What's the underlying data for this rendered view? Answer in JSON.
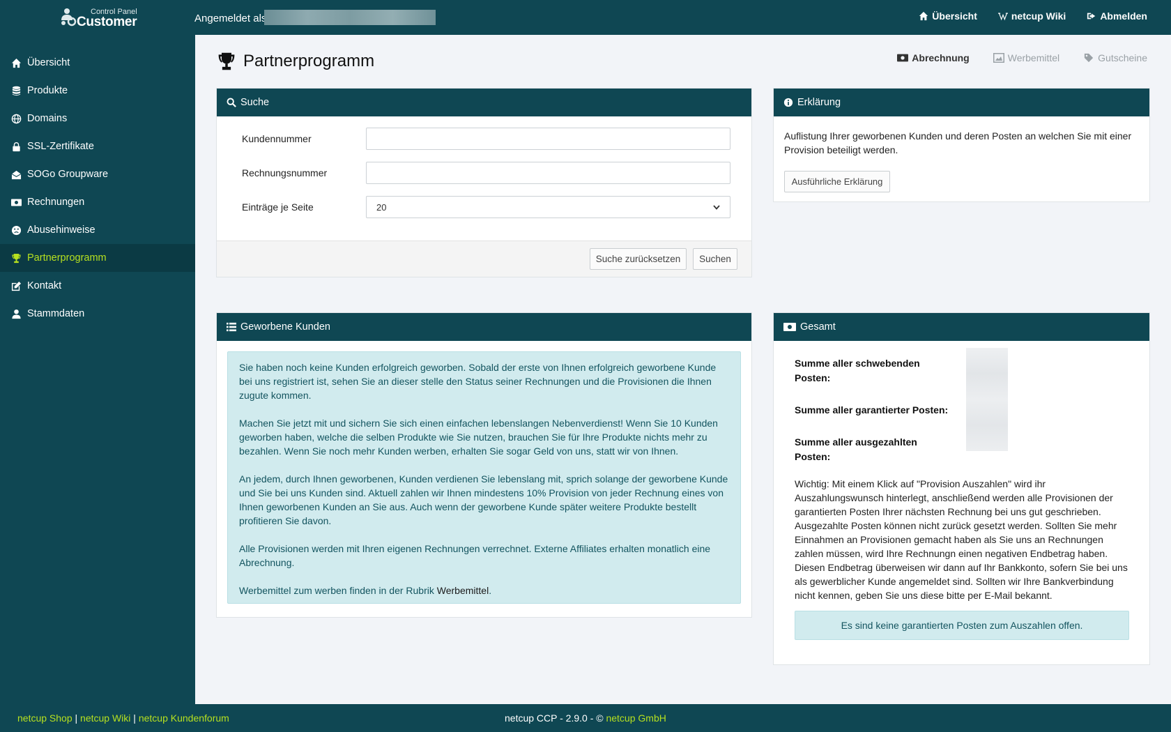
{
  "header": {
    "logo_small": "Control Panel",
    "logo_big": "Customer",
    "logged_in_label": "Angemeldet als",
    "nav": [
      {
        "label": "Übersicht",
        "icon": "home-icon"
      },
      {
        "label": "netcup Wiki",
        "icon": "wikipedia-icon"
      },
      {
        "label": "Abmelden",
        "icon": "sign-out-icon"
      }
    ]
  },
  "sidebar": {
    "items": [
      {
        "label": "Übersicht",
        "icon": "home-icon",
        "active": false
      },
      {
        "label": "Produkte",
        "icon": "database-icon",
        "active": false
      },
      {
        "label": "Domains",
        "icon": "globe-icon",
        "active": false
      },
      {
        "label": "SSL-Zertifikate",
        "icon": "lock-icon",
        "active": false
      },
      {
        "label": "SOGo Groupware",
        "icon": "envelope-open-icon",
        "active": false
      },
      {
        "label": "Rechnungen",
        "icon": "money-icon",
        "active": false
      },
      {
        "label": "Abusehinweise",
        "icon": "frown-icon",
        "active": false
      },
      {
        "label": "Partnerprogramm",
        "icon": "trophy-icon",
        "active": true
      },
      {
        "label": "Kontakt",
        "icon": "edit-icon",
        "active": false
      },
      {
        "label": "Stammdaten",
        "icon": "user-icon",
        "active": false
      }
    ]
  },
  "page": {
    "title": "Partnerprogramm",
    "tabs": [
      {
        "label": "Abrechnung",
        "icon": "money-icon",
        "active": true
      },
      {
        "label": "Werbemittel",
        "icon": "image-icon",
        "active": false
      },
      {
        "label": "Gutscheine",
        "icon": "tag-icon",
        "active": false
      }
    ]
  },
  "search": {
    "title": "Suche",
    "customer_number_label": "Kundennummer",
    "customer_number_value": "",
    "invoice_number_label": "Rechnungsnummer",
    "invoice_number_value": "",
    "per_page_label": "Einträge je Seite",
    "per_page_value": "20",
    "reset_button": "Suche zurücksetzen",
    "search_button": "Suchen"
  },
  "explanation": {
    "title": "Erklärung",
    "text": "Auflistung Ihrer geworbenen Kunden und deren Posten an welchen Sie mit einer Provision beteiligt werden.",
    "button": "Ausführliche Erklärung"
  },
  "customers": {
    "title": "Geworbene Kunden",
    "paragraphs": [
      "Sie haben noch keine Kunden erfolgreich geworben. Sobald der erste von Ihnen erfolgreich geworbene Kunde bei uns registriert ist, sehen Sie an dieser stelle den Status seiner Rechnungen und die Provisionen die Ihnen zugute kommen.",
      "Machen Sie jetzt mit und sichern Sie sich einen einfachen lebenslangen Nebenverdienst! Wenn Sie 10 Kunden geworben haben, welche die selben Produkte wie Sie nutzen, brauchen Sie für Ihre Produkte nichts mehr zu bezahlen. Wenn Sie noch mehr Kunden werben, erhalten Sie sogar Geld von uns, statt wir von Ihnen.",
      "An jedem, durch Ihnen geworbenen, Kunden verdienen Sie lebenslang mit, sprich solange der geworbene Kunde und Sie bei uns Kunden sind. Aktuell zahlen wir Ihnen mindestens 10% Provision von jeder Rechnung eines von Ihnen geworbenen Kunden an Sie aus. Auch wenn der geworbene Kunde später weitere Produkte bestellt profitieren Sie davon.",
      "Alle Provisionen werden mit Ihren eigenen Rechnungen verrechnet. Externe Affiliates erhalten monatlich eine Abrechnung."
    ],
    "last_prefix": "Werbemittel zum werben finden in der Rubrik",
    "last_link": "Werbemittel",
    "last_suffix": "."
  },
  "total": {
    "title": "Gesamt",
    "pending_label": "Summe aller schwebenden Posten:",
    "guaranteed_label": "Summe aller garantierter Posten:",
    "paid_label": "Summe aller ausgezahlten Posten:",
    "notice": "Wichtig: Mit einem Klick auf \"Provision Auszahlen\" wird ihr Auszahlungswunsch hinterlegt, anschließend werden alle Provisionen der garantierten Posten Ihrer nächsten Rechnung bei uns gut geschrieben. Ausgezahlte Posten können nicht zurück gesetzt werden. Sollten Sie mehr Einnahmen an Provisionen gemacht haben als Sie uns an Rechnungen zahlen müssen, wird Ihre Rechnungn einen negativen Endbetrag haben. Diesen Endbetrag überweisen wir dann auf Ihr Bankkonto, sofern Sie bei uns als gewerblicher Kunde angemeldet sind. Sollten wir Ihre Bankverbindung nicht kennen, geben Sie uns diese bitte per E-Mail bekannt.",
    "no_items": "Es sind keine garantierten Posten zum Auszahlen offen."
  },
  "footer": {
    "links": [
      "netcup Shop",
      "netcup Wiki",
      "netcup Kundenforum"
    ],
    "separator": "|",
    "version_text": "netcup CCP - 2.9.0 - ©",
    "company": "netcup GmbH"
  },
  "colors": {
    "primary": "#0f4753",
    "accent": "#b7e11f",
    "info_bg": "#d1ebee"
  }
}
